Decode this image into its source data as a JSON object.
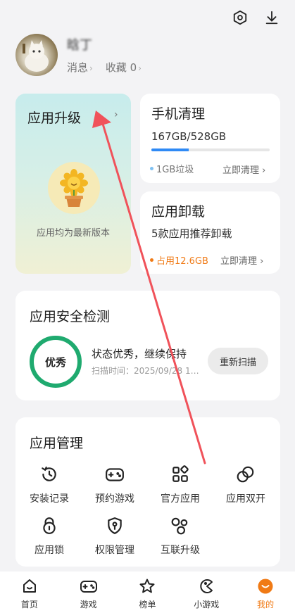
{
  "profile": {
    "username": "晗丁",
    "messages_label": "消息",
    "favorites_label": "收藏",
    "favorites_count": "0"
  },
  "upgrade": {
    "title": "应用升级",
    "caption": "应用均为最新版本"
  },
  "cleanup": {
    "title": "手机清理",
    "storage": "167GB/528GB",
    "storage_fraction": 0.316,
    "junk": "1GB垃圾",
    "action": "立即清理"
  },
  "uninstall": {
    "title": "应用卸载",
    "subtitle": "5款应用推荐卸载",
    "occupied": "占用12.6GB",
    "action": "立即清理"
  },
  "security": {
    "title": "应用安全检测",
    "score": "优秀",
    "status": "状态优秀，继续保持",
    "scan_time": "扫描时间：2025/09/28 1…",
    "rescan": "重新扫描"
  },
  "management": {
    "title": "应用管理",
    "items": [
      {
        "label": "安装记录",
        "icon": "history-icon"
      },
      {
        "label": "预约游戏",
        "icon": "gamepad-icon"
      },
      {
        "label": "官方应用",
        "icon": "apps-icon"
      },
      {
        "label": "应用双开",
        "icon": "dual-circles-icon"
      },
      {
        "label": "应用锁",
        "icon": "lock-icon"
      },
      {
        "label": "权限管理",
        "icon": "shield-key-icon"
      },
      {
        "label": "互联升级",
        "icon": "connect-icon"
      }
    ]
  },
  "nav": {
    "items": [
      {
        "label": "首页"
      },
      {
        "label": "游戏"
      },
      {
        "label": "榜单"
      },
      {
        "label": "小游戏"
      },
      {
        "label": "我的"
      }
    ]
  },
  "colors": {
    "accent_orange": "#f07a15",
    "progress_blue": "#2f8af5",
    "score_green": "#1faa6f",
    "annotation_red": "#f0525a"
  }
}
